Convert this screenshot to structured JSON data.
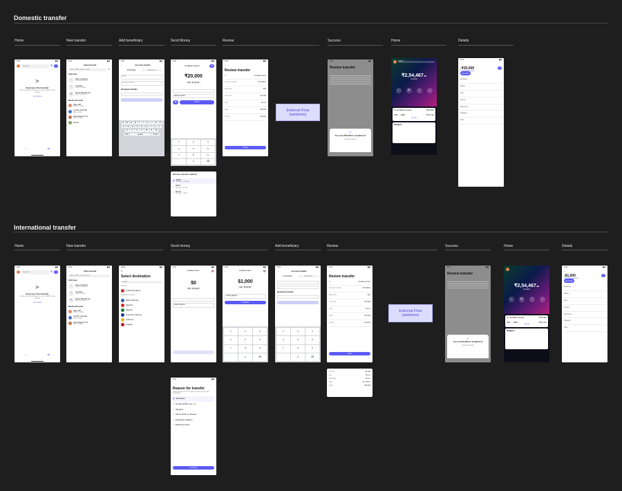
{
  "domestic": {
    "title": "Domestic transfer",
    "columns": [
      "Home",
      "New transfer",
      "Add beneficiary",
      "Send Money",
      "Review",
      "Success",
      "Home",
      "Details"
    ]
  },
  "international": {
    "title": "International transfer",
    "columns": [
      "Home",
      "New transfer",
      "Send money",
      "Add beneficiary",
      "Review",
      "Success",
      "Home",
      "Details"
    ]
  },
  "external_flow": {
    "line1": "External Flow",
    "line2": "(webview)"
  },
  "home": {
    "search": "Search",
    "empty_title": "Send your first transfer",
    "empty_desc": "Send a transfer to people in your contacts to get started",
    "link": "Get started"
  },
  "new_transfer": {
    "title": "New transfer",
    "search": "Name, IBAN, phone, email",
    "add_new": "Add new",
    "options": [
      {
        "title": "New recipient",
        "desc": "Add bank details"
      },
      {
        "title": "Contact",
        "desc": "Add a contact"
      },
      {
        "title": "Send Merchants",
        "desc": "Pay merchants"
      }
    ],
    "bank_accounts": "Bank accounts",
    "accounts": [
      {
        "name": "Alex Hill",
        "desc": "HDFC •• 1234"
      },
      {
        "name": "Cedric Geralde",
        "desc": "SBI •• 5678"
      },
      {
        "name": "Hyperlogica Ltd",
        "desc": "ICICI •• 9012"
      },
      {
        "name": "Name",
        "desc": ""
      }
    ]
  },
  "add_beneficiary": {
    "title": "Account details",
    "tabs": [
      "Individual",
      "Business"
    ],
    "fields": [
      "IFSC",
      "Account number"
    ],
    "recipient": "Recipient details",
    "keys_row1": [
      "Q",
      "W",
      "E",
      "R",
      "T",
      "Y",
      "U",
      "I",
      "O",
      "P"
    ],
    "keys_row2": [
      "A",
      "S",
      "D",
      "F",
      "G",
      "H",
      "J",
      "K",
      "L"
    ],
    "keys_row3": [
      "Z",
      "X",
      "C",
      "V",
      "B",
      "N",
      "M"
    ],
    "space": "space",
    "return": "return"
  },
  "send_money": {
    "recipient": "Jonathan Keane",
    "amount_inr": "₹20,000",
    "balance": "INR · ₹2,54,467",
    "purpose": "Family support",
    "send": "Send",
    "transfer_method_title": "Choose transfer method",
    "methods": [
      {
        "name": "IMPS",
        "desc": "Arriving · Instantly"
      },
      {
        "name": "NEFT",
        "desc": "Arriving · 30 mins"
      },
      {
        "name": "RTGS",
        "desc": "Arriving · 1 hour"
      }
    ],
    "keypad": [
      "1",
      "2",
      "3",
      "4",
      "5",
      "6",
      "7",
      "8",
      "9",
      ".",
      "0",
      "⌫"
    ]
  },
  "review": {
    "title": "Review transfer",
    "rows": [
      {
        "k": "To",
        "v": "Jonathan Keane"
      },
      {
        "k": "Account number",
        "v": "XXXX4521"
      },
      {
        "k": "Reference",
        "v": "Edit"
      },
      {
        "k": "You send",
        "v": "₹20,000"
      },
      {
        "k": "Fees",
        "v": "No fee"
      },
      {
        "k": "Total",
        "v": "₹20,000"
      },
      {
        "k": "Arrives",
        "v": "Instantly"
      }
    ],
    "button": "Send"
  },
  "success": {
    "domestic_msg": "You sent ₹20,000 to Jonathan K",
    "international_msg": "You sent $1,000 to Jonathan K",
    "status": "Arriving instantly"
  },
  "home_full": {
    "balance_domestic": "₹2,54,467",
    "balance_intl": "₹2,54,467",
    "decimals": ".88",
    "label": "Accounts",
    "actions": [
      "Add money",
      "Exchange",
      "Move",
      "More"
    ],
    "tx1_name": "To Jonathan Keane",
    "tx1_val": "-₹20,000",
    "tx2_name": "INR → GBP",
    "tx2_val": "-₹10,742",
    "see_all": "See all",
    "widgets": "Widgets"
  },
  "details": {
    "amount_domestic": "-₹20,000",
    "amount_intl": "-$1,000",
    "to": "To Jonathan Keane",
    "status_chip": "Sent",
    "lines": [
      "Recipient",
      "Status",
      "Sent",
      "Arrived",
      "Reference",
      "Category",
      "Note"
    ],
    "payment_note": "Get help"
  },
  "destination": {
    "title": "Select destination",
    "search": "Search",
    "recent": "Recents",
    "recent_item": "United Kingdom",
    "all": "Available countries",
    "countries": [
      "Åland Islands",
      "Albania",
      "Algeria",
      "American Samoa",
      "Andorra",
      "Angola"
    ]
  },
  "send_intl": {
    "zero": "$0",
    "amount": "$1,000",
    "recipient": "Jonathan Keane",
    "continue": "Continue",
    "reason_title": "Reason for transfer",
    "reason_desc": "Select reason for this transfer to help comply with regulations",
    "reasons": [
      "Education",
      "Goods (FOB), Imp. of",
      "Vacation",
      "Gift to family or friends",
      "Employee salaries",
      "Business travel"
    ],
    "continue_btn": "Continue"
  },
  "fx_card": {
    "rows": [
      {
        "k": "Amount",
        "v": "$1,000"
      },
      {
        "k": "Fee",
        "v": "No fee"
      },
      {
        "k": "Exchange",
        "v": "No fee"
      },
      {
        "k": "Rate",
        "v": "1 $ = ₹83.2"
      },
      {
        "k": "Total",
        "v": "₹83,200"
      }
    ]
  },
  "colors": {
    "accent": "#5b5bf5",
    "bg": "#1e1e1e"
  }
}
